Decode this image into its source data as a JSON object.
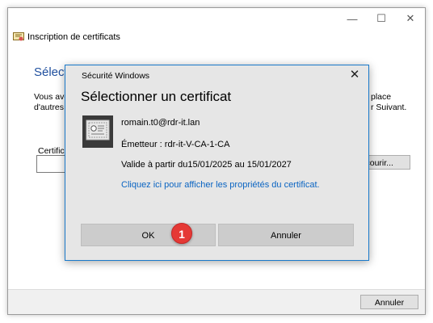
{
  "wizard": {
    "title": "Inscription de certificats",
    "caption_minimize": "—",
    "caption_maximize": "☐",
    "caption_close": "✕",
    "heading_partial": "Sélectio",
    "text_left_line1": "Vous ave",
    "text_left_line2": "d'autres",
    "text_right_line1": "place",
    "text_right_line2": "r Suivant.",
    "cert_label_partial": "Certifica",
    "browse_partial": "rcourir...",
    "cancel_label": "Annuler"
  },
  "dialog": {
    "title": "Sécurité Windows",
    "close_glyph": "✕",
    "heading": "Sélectionner un certificat",
    "cert_subject": "romain.t0@rdr-it.lan",
    "issuer": "Émetteur : rdr-it-V-CA-1-CA",
    "validity": "Valide à partir du15/01/2025 au 15/01/2027",
    "link": "Cliquez ici pour afficher les propriétés du certificat.",
    "ok_label": "OK",
    "cancel_label": "Annuler"
  },
  "annotation": {
    "badge_number": "1",
    "badge_color": "#e53935"
  },
  "icons": [
    "certificate-icon",
    "close-icon",
    "minimize-icon",
    "maximize-icon"
  ]
}
